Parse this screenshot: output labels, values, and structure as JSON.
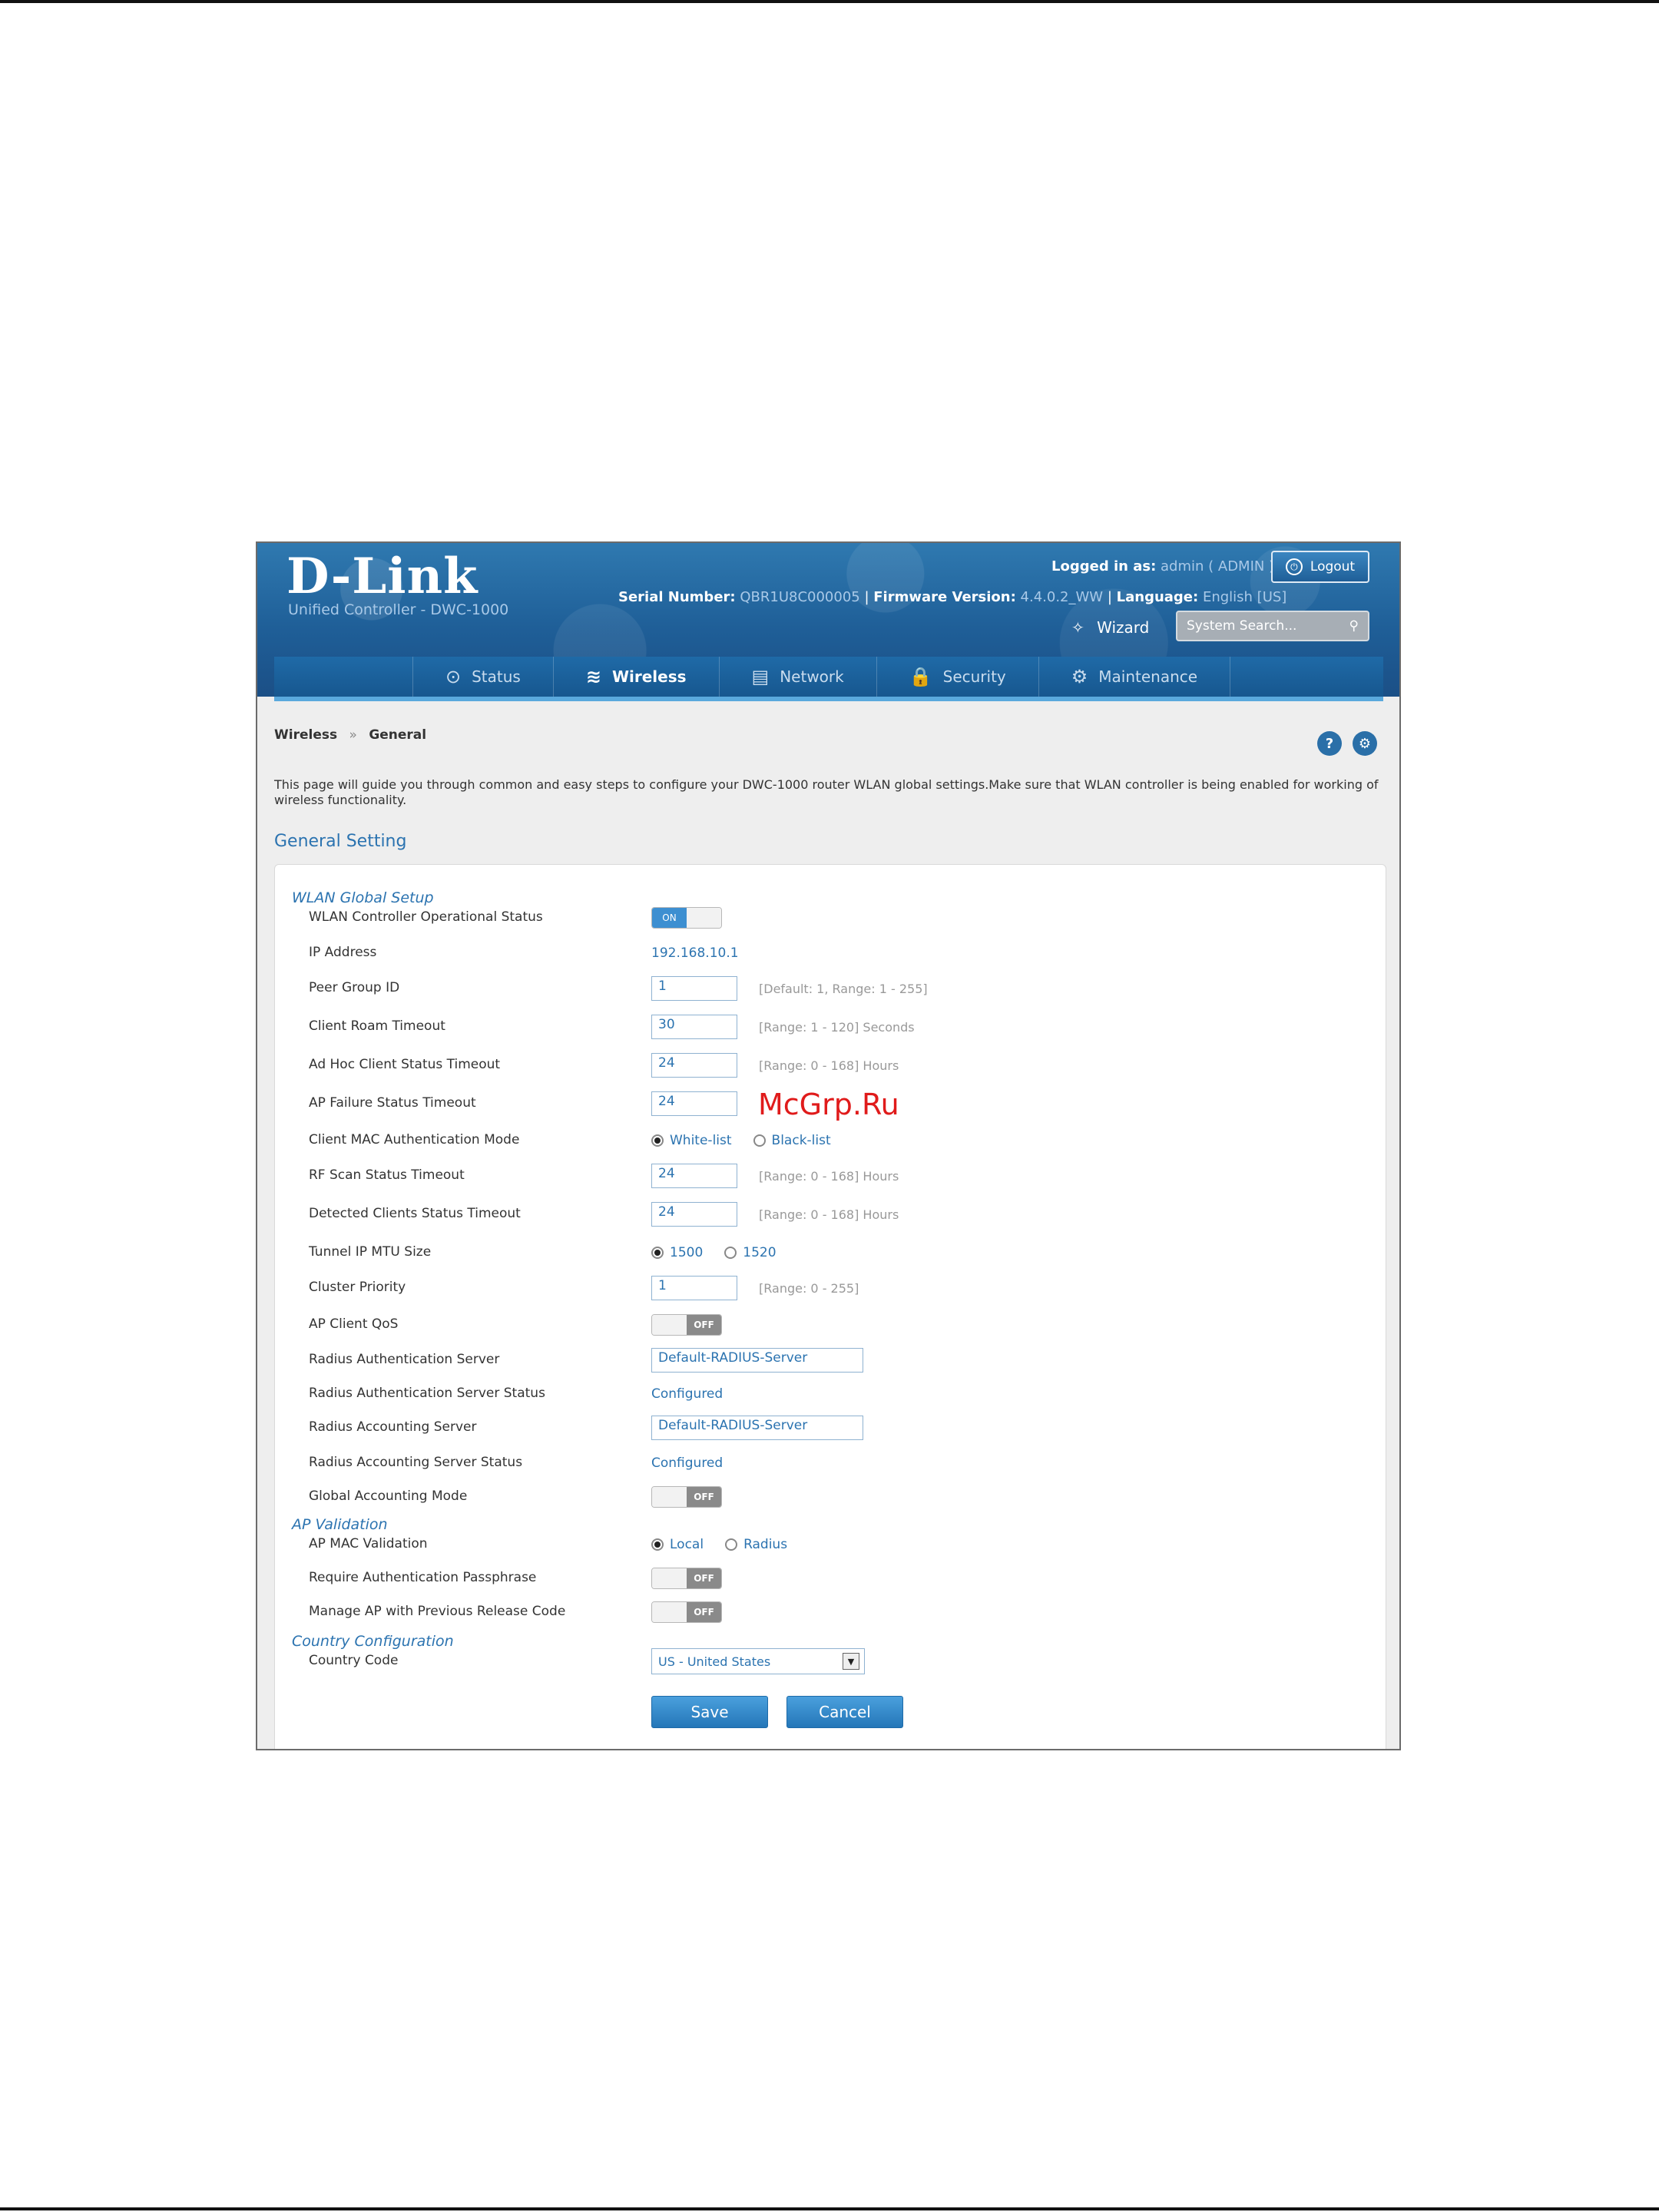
{
  "header": {
    "logo": "D-Link",
    "logo_sub": "Unified Controller - DWC-1000",
    "serial_label": "Serial Number:",
    "serial_value": "QBR1U8C000005",
    "firmware_label": "Firmware Version:",
    "firmware_value": "4.4.0.2_WW",
    "language_label": "Language:",
    "language_value": "English [US]",
    "logged_in_label": "Logged in as:",
    "logged_in_value": "admin ( ADMIN )",
    "logout_label": "Logout",
    "wizard_label": "Wizard",
    "search_placeholder": "System Search..."
  },
  "nav": {
    "items": [
      {
        "label": "Status",
        "icon": "gauge-icon",
        "glyph": "⊙"
      },
      {
        "label": "Wireless",
        "icon": "wifi-icon",
        "glyph": "≋"
      },
      {
        "label": "Network",
        "icon": "list-icon",
        "glyph": "▤"
      },
      {
        "label": "Security",
        "icon": "lock-icon",
        "glyph": "🔒"
      },
      {
        "label": "Maintenance",
        "icon": "gears-icon",
        "glyph": "⚙"
      }
    ],
    "active": "Wireless"
  },
  "breadcrumb": {
    "parent": "Wireless",
    "separator": "»",
    "current": "General"
  },
  "intro": "This page will guide you through common and easy steps to configure your DWC-1000 router WLAN global settings.Make sure that WLAN controller is being enabled for working of wireless functionality.",
  "section_title": "General Setting",
  "groups": {
    "wlan": "WLAN Global Setup",
    "ap": "AP Validation",
    "country": "Country Configuration"
  },
  "fields": {
    "op_status": {
      "label": "WLAN Controller Operational Status",
      "on": "ON",
      "off": ""
    },
    "ip": {
      "label": "IP Address",
      "value": "192.168.10.1"
    },
    "peer_group": {
      "label": "Peer Group ID",
      "value": "1",
      "hint": "[Default: 1, Range: 1 - 255]"
    },
    "roam_timeout": {
      "label": "Client Roam Timeout",
      "value": "30",
      "hint": "[Range: 1 - 120] Seconds"
    },
    "adhoc_timeout": {
      "label": "Ad Hoc Client Status Timeout",
      "value": "24",
      "hint": "[Range: 0 - 168] Hours"
    },
    "ap_failure": {
      "label": "AP Failure Status Timeout",
      "value": "24",
      "hint": ""
    },
    "mac_mode": {
      "label": "Client MAC Authentication Mode",
      "opt1": "White-list",
      "opt2": "Black-list"
    },
    "rf_scan": {
      "label": "RF Scan Status Timeout",
      "value": "24",
      "hint": "[Range: 0 - 168] Hours"
    },
    "detected": {
      "label": "Detected Clients Status Timeout",
      "value": "24",
      "hint": "[Range: 0 - 168] Hours"
    },
    "mtu": {
      "label": "Tunnel IP MTU Size",
      "opt1": "1500",
      "opt2": "1520"
    },
    "cluster": {
      "label": "Cluster Priority",
      "value": "1",
      "hint": "[Range: 0 - 255]"
    },
    "ap_qos": {
      "label": "AP Client QoS",
      "off": "OFF"
    },
    "radius_auth": {
      "label": "Radius Authentication Server",
      "value": "Default-RADIUS-Server"
    },
    "radius_auth_status": {
      "label": "Radius Authentication Server Status",
      "value": "Configured"
    },
    "radius_acct": {
      "label": "Radius Accounting Server",
      "value": "Default-RADIUS-Server"
    },
    "radius_acct_status": {
      "label": "Radius Accounting Server Status",
      "value": "Configured"
    },
    "global_acct": {
      "label": "Global Accounting Mode",
      "off": "OFF"
    },
    "ap_mac": {
      "label": "AP MAC Validation",
      "opt1": "Local",
      "opt2": "Radius"
    },
    "require_pass": {
      "label": "Require Authentication Passphrase",
      "off": "OFF"
    },
    "manage_ap": {
      "label": "Manage AP with Previous Release Code",
      "off": "OFF"
    },
    "country_code": {
      "label": "Country Code",
      "value": "US - United States"
    }
  },
  "buttons": {
    "save": "Save",
    "cancel": "Cancel"
  },
  "watermark": "McGrp.Ru"
}
